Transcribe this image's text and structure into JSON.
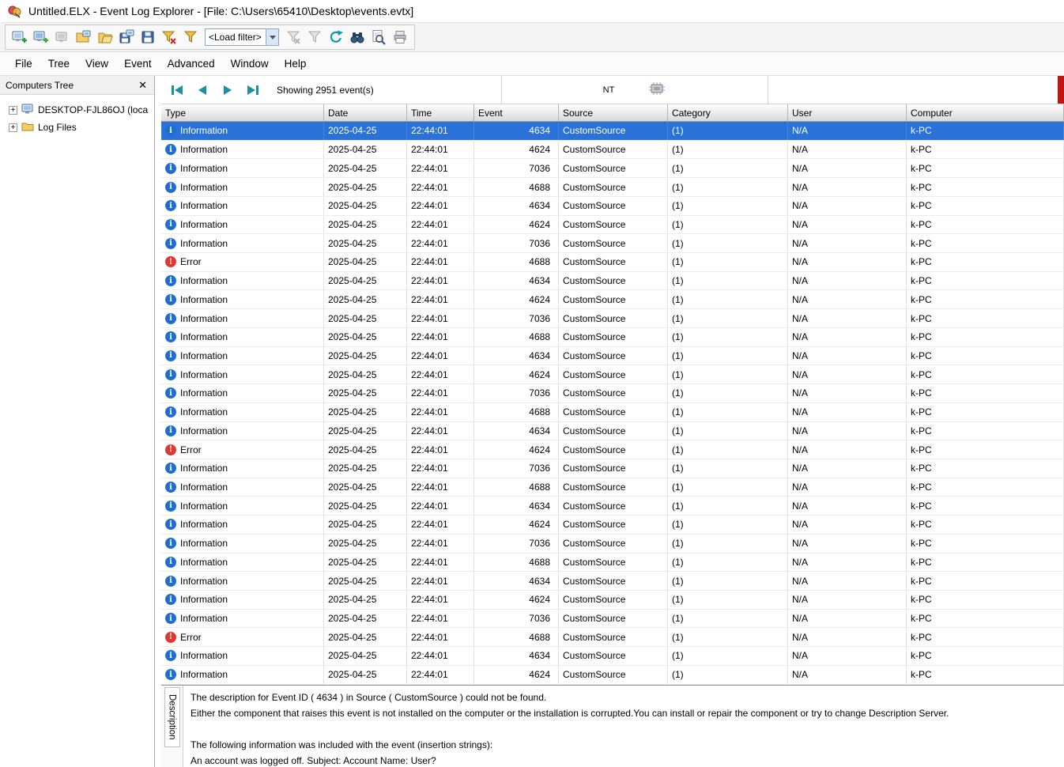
{
  "window": {
    "title": "Untitled.ELX - Event Log Explorer - [File: C:\\Users\\65410\\Desktop\\events.evtx]"
  },
  "menu": {
    "items": [
      "File",
      "Tree",
      "View",
      "Event",
      "Advanced",
      "Window",
      "Help"
    ]
  },
  "toolbar": {
    "load_filter": "<Load filter>",
    "icons": [
      "new-workspace",
      "add-computer",
      "remove-computer",
      "open-workspace",
      "open-log-file",
      "save-workspace",
      "save",
      "clear-filter",
      "filter",
      "load-filter-dropdown",
      "filter-disabled-x",
      "filter-disabled",
      "refresh",
      "find",
      "view-details",
      "print"
    ]
  },
  "computers_tree": {
    "title": "Computers Tree",
    "items": [
      {
        "label": "DESKTOP-FJL86OJ (loca",
        "icon": "computer-icon"
      },
      {
        "label": "Log Files",
        "icon": "folder-icon"
      }
    ]
  },
  "statusbar": {
    "showing": "Showing 2951 event(s)",
    "nt": "NT"
  },
  "table": {
    "columns": [
      "Type",
      "Date",
      "Time",
      "Event",
      "Source",
      "Category",
      "User",
      "Computer"
    ],
    "selected_index": 0,
    "row_defaults": {
      "date": "2025-04-25",
      "time": "22:44:01",
      "source": "CustomSource",
      "category": "(1)",
      "user": "N/A",
      "computer": "k-PC"
    },
    "rows": [
      {
        "type": "Information",
        "event": "4634"
      },
      {
        "type": "Information",
        "event": "4624"
      },
      {
        "type": "Information",
        "event": "7036"
      },
      {
        "type": "Information",
        "event": "4688"
      },
      {
        "type": "Information",
        "event": "4634"
      },
      {
        "type": "Information",
        "event": "4624"
      },
      {
        "type": "Information",
        "event": "7036"
      },
      {
        "type": "Error",
        "event": "4688"
      },
      {
        "type": "Information",
        "event": "4634"
      },
      {
        "type": "Information",
        "event": "4624"
      },
      {
        "type": "Information",
        "event": "7036"
      },
      {
        "type": "Information",
        "event": "4688"
      },
      {
        "type": "Information",
        "event": "4634"
      },
      {
        "type": "Information",
        "event": "4624"
      },
      {
        "type": "Information",
        "event": "7036"
      },
      {
        "type": "Information",
        "event": "4688"
      },
      {
        "type": "Information",
        "event": "4634"
      },
      {
        "type": "Error",
        "event": "4624"
      },
      {
        "type": "Information",
        "event": "7036"
      },
      {
        "type": "Information",
        "event": "4688"
      },
      {
        "type": "Information",
        "event": "4634"
      },
      {
        "type": "Information",
        "event": "4624"
      },
      {
        "type": "Information",
        "event": "7036"
      },
      {
        "type": "Information",
        "event": "4688"
      },
      {
        "type": "Information",
        "event": "4634"
      },
      {
        "type": "Information",
        "event": "4624"
      },
      {
        "type": "Information",
        "event": "7036"
      },
      {
        "type": "Error",
        "event": "4688"
      },
      {
        "type": "Information",
        "event": "4634"
      },
      {
        "type": "Information",
        "event": "4624"
      }
    ]
  },
  "description": {
    "tab": "Description",
    "lines": [
      "The description for Event ID ( 4634 ) in Source ( CustomSource ) could not be found.",
      "Either the component that raises this event is not installed on the computer or the installation is corrupted.You can install or repair the component or try to change Description Server.",
      "",
      "The following information was included with the event (insertion strings):",
      "An account was logged off. Subject: Account Name: User?"
    ]
  },
  "colors": {
    "selection": "#2a72d7",
    "info_icon": "#1d6ed0",
    "error_icon": "#d93a32",
    "nav_arrow": "#18929e",
    "red_indicator": "#c31414"
  }
}
